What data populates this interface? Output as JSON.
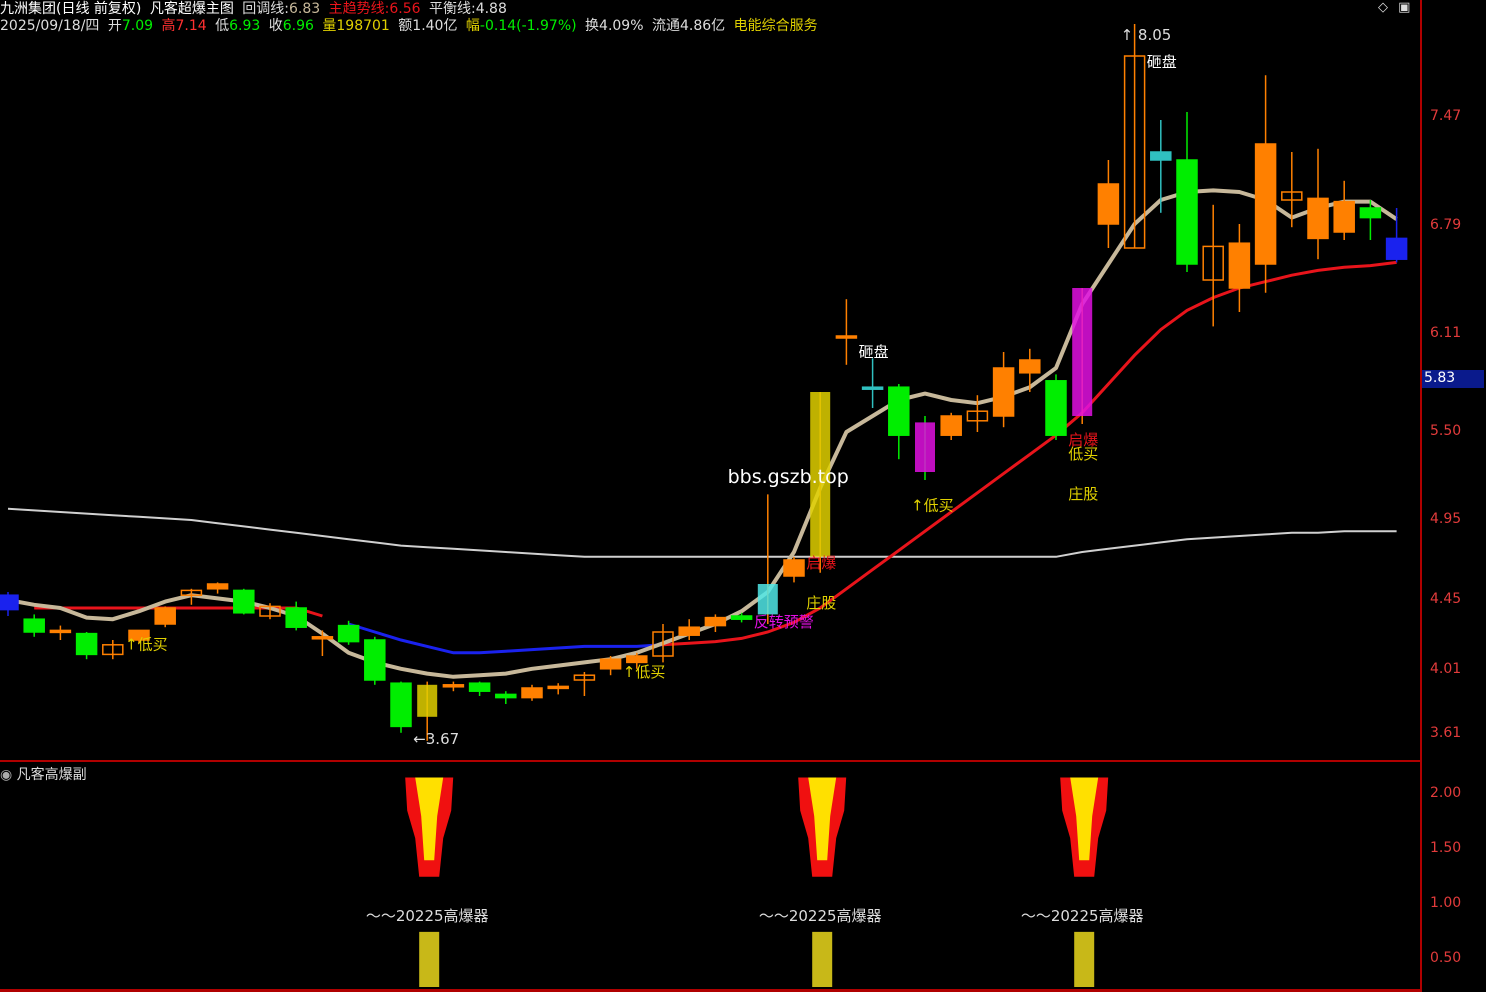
{
  "header": {
    "stock": "九洲集团(日线 前复权)",
    "indicator_name": "凡客超爆主图",
    "callback_label": "回调线:",
    "callback_value": "6.83",
    "trend_label": "主趋势线:",
    "trend_value": "6.56",
    "balance_label": "平衡线:",
    "balance_value": "4.88",
    "date": "2025/09/18/四",
    "open_label": "开",
    "open": "7.09",
    "high_label": "高",
    "high": "7.14",
    "low_label": "低",
    "low": "6.93",
    "close_label": "收",
    "close": "6.96",
    "vol_label": "量",
    "vol": "198701",
    "amt_label": "额",
    "amt": "1.40亿",
    "chg_label": "幅",
    "chg": "-0.14(-1.97%)",
    "turn_label": "换",
    "turn": "4.09%",
    "float_label": "流通",
    "float": "4.86亿",
    "sector": "电能综合服务"
  },
  "sub_panel": {
    "title": "凡客高爆副"
  },
  "colors": {
    "up": "#ff8000",
    "down": "#00ee00",
    "trend": "#e8141b",
    "callback": "#c7b89a",
    "balance": "#d0d0d0",
    "blue": "#1a22ee",
    "magenta": "#e010e0",
    "yellow": "#e0d000"
  },
  "chart_data": [
    {
      "type": "candlestick",
      "title": "凡客超爆主图",
      "ylim": [
        3.5,
        7.95
      ],
      "price_ticks": [
        "7.47",
        "6.79",
        "6.11",
        "5.83",
        "5.50",
        "4.95",
        "4.45",
        "4.01",
        "3.61"
      ],
      "current_price": "5.83",
      "candles": [
        {
          "o": 4.39,
          "c": 4.48,
          "h": 4.5,
          "l": 4.35
        },
        {
          "o": 4.33,
          "c": 4.25,
          "h": 4.36,
          "l": 4.22
        },
        {
          "o": 4.26,
          "c": 4.26,
          "h": 4.29,
          "l": 4.2
        },
        {
          "o": 4.24,
          "c": 4.11,
          "h": 4.25,
          "l": 4.08
        },
        {
          "o": 4.11,
          "c": 4.17,
          "h": 4.2,
          "l": 4.08
        },
        {
          "o": 4.2,
          "c": 4.26,
          "h": 4.26,
          "l": 4.18
        },
        {
          "o": 4.3,
          "c": 4.4,
          "h": 4.41,
          "l": 4.28
        },
        {
          "o": 4.48,
          "c": 4.51,
          "h": 4.52,
          "l": 4.42
        },
        {
          "o": 4.52,
          "c": 4.55,
          "h": 4.56,
          "l": 4.49
        },
        {
          "o": 4.51,
          "c": 4.37,
          "h": 4.52,
          "l": 4.36
        },
        {
          "o": 4.35,
          "c": 4.41,
          "h": 4.43,
          "l": 4.33
        },
        {
          "o": 4.4,
          "c": 4.28,
          "h": 4.44,
          "l": 4.26
        },
        {
          "o": 4.22,
          "c": 4.22,
          "h": 4.26,
          "l": 4.1
        },
        {
          "o": 4.29,
          "c": 4.19,
          "h": 4.32,
          "l": 4.17
        },
        {
          "o": 4.2,
          "c": 3.95,
          "h": 4.22,
          "l": 3.92
        },
        {
          "o": 3.93,
          "c": 3.66,
          "h": 3.94,
          "l": 3.62
        },
        {
          "o": 3.72,
          "c": 3.92,
          "h": 3.94,
          "l": 3.57
        },
        {
          "o": 3.92,
          "c": 3.92,
          "h": 3.94,
          "l": 3.88
        },
        {
          "o": 3.93,
          "c": 3.88,
          "h": 3.94,
          "l": 3.85
        },
        {
          "o": 3.86,
          "c": 3.84,
          "h": 3.88,
          "l": 3.8
        },
        {
          "o": 3.84,
          "c": 3.9,
          "h": 3.92,
          "l": 3.82
        },
        {
          "o": 3.9,
          "c": 3.91,
          "h": 3.93,
          "l": 3.86
        },
        {
          "o": 3.95,
          "c": 3.98,
          "h": 4.0,
          "l": 3.85
        },
        {
          "o": 4.02,
          "c": 4.08,
          "h": 4.1,
          "l": 3.98
        },
        {
          "o": 4.06,
          "c": 4.1,
          "h": 4.12,
          "l": 4.02
        },
        {
          "o": 4.1,
          "c": 4.25,
          "h": 4.3,
          "l": 4.06
        },
        {
          "o": 4.23,
          "c": 4.28,
          "h": 4.33,
          "l": 4.2
        },
        {
          "o": 4.29,
          "c": 4.34,
          "h": 4.36,
          "l": 4.25
        },
        {
          "o": 4.35,
          "c": 4.33,
          "h": 4.37,
          "l": 4.31
        },
        {
          "o": 4.36,
          "c": 4.55,
          "h": 5.11,
          "l": 4.3
        },
        {
          "o": 4.6,
          "c": 4.7,
          "h": 4.72,
          "l": 4.56
        },
        {
          "o": 4.72,
          "c": 5.75,
          "h": 5.75,
          "l": 4.62
        },
        {
          "o": 6.1,
          "c": 6.1,
          "h": 6.33,
          "l": 5.92
        },
        {
          "o": 5.78,
          "c": 5.78,
          "h": 5.96,
          "l": 5.65
        },
        {
          "o": 5.78,
          "c": 5.48,
          "h": 5.8,
          "l": 5.33
        },
        {
          "o": 5.56,
          "c": 5.25,
          "h": 5.6,
          "l": 5.2
        },
        {
          "o": 5.48,
          "c": 5.6,
          "h": 5.62,
          "l": 5.45
        },
        {
          "o": 5.57,
          "c": 5.63,
          "h": 5.73,
          "l": 5.5
        },
        {
          "o": 5.6,
          "c": 5.9,
          "h": 6.0,
          "l": 5.53
        },
        {
          "o": 5.87,
          "c": 5.95,
          "h": 6.02,
          "l": 5.75
        },
        {
          "o": 5.82,
          "c": 5.48,
          "h": 5.86,
          "l": 5.45
        },
        {
          "o": 5.6,
          "c": 6.4,
          "h": 6.4,
          "l": 5.55
        },
        {
          "o": 6.8,
          "c": 7.05,
          "h": 7.2,
          "l": 6.65
        },
        {
          "o": 6.65,
          "c": 7.85,
          "h": 8.05,
          "l": 6.65
        },
        {
          "o": 7.2,
          "c": 7.25,
          "h": 7.45,
          "l": 6.87
        },
        {
          "o": 7.2,
          "c": 6.55,
          "h": 7.5,
          "l": 6.5
        },
        {
          "o": 6.45,
          "c": 6.66,
          "h": 6.92,
          "l": 6.16
        },
        {
          "o": 6.4,
          "c": 6.68,
          "h": 6.8,
          "l": 6.25
        },
        {
          "o": 6.55,
          "c": 7.3,
          "h": 7.73,
          "l": 6.37
        },
        {
          "o": 6.95,
          "c": 7.0,
          "h": 7.25,
          "l": 6.78
        },
        {
          "o": 6.71,
          "c": 6.96,
          "h": 7.27,
          "l": 6.58
        },
        {
          "o": 6.75,
          "c": 6.94,
          "h": 7.07,
          "l": 6.7
        },
        {
          "o": 6.9,
          "c": 6.84,
          "h": 6.95,
          "l": 6.7
        },
        {
          "o": 6.71,
          "c": 6.58,
          "h": 6.9,
          "l": 6.56
        }
      ],
      "callback_line": [
        4.45,
        4.42,
        4.4,
        4.34,
        4.33,
        4.38,
        4.44,
        4.48,
        4.46,
        4.44,
        4.4,
        4.35,
        4.24,
        4.12,
        4.06,
        4.02,
        3.99,
        3.97,
        3.98,
        3.99,
        4.02,
        4.04,
        4.06,
        4.08,
        4.12,
        4.18,
        4.24,
        4.3,
        4.38,
        4.5,
        4.75,
        5.15,
        5.5,
        5.6,
        5.7,
        5.74,
        5.7,
        5.68,
        5.72,
        5.78,
        5.9,
        6.3,
        6.55,
        6.8,
        6.95,
        7.0,
        7.01,
        7.0,
        6.95,
        6.84,
        6.9,
        6.94,
        6.94,
        6.83
      ],
      "trend_line": [
        4.4,
        4.4,
        4.4,
        4.4,
        4.4,
        4.4,
        4.4,
        4.4,
        4.4,
        4.4,
        4.4,
        4.35,
        4.3,
        4.25,
        4.2,
        4.16,
        4.12,
        4.12,
        4.13,
        4.14,
        4.15,
        4.16,
        4.16,
        4.16,
        4.17,
        4.18,
        4.19,
        4.21,
        4.25,
        4.31,
        4.4,
        4.52,
        4.64,
        4.76,
        4.88,
        5.0,
        5.12,
        5.24,
        5.36,
        5.48,
        5.62,
        5.8,
        5.98,
        6.14,
        6.26,
        6.34,
        6.4,
        6.44,
        6.48,
        6.51,
        6.53,
        6.54,
        6.56
      ],
      "balance_line": [
        5.02,
        5.01,
        5.0,
        4.99,
        4.98,
        4.97,
        4.96,
        4.95,
        4.93,
        4.91,
        4.89,
        4.87,
        4.85,
        4.83,
        4.81,
        4.79,
        4.78,
        4.77,
        4.76,
        4.75,
        4.74,
        4.73,
        4.72,
        4.72,
        4.72,
        4.72,
        4.72,
        4.72,
        4.72,
        4.72,
        4.72,
        4.72,
        4.72,
        4.72,
        4.72,
        4.72,
        4.72,
        4.72,
        4.72,
        4.72,
        4.72,
        4.75,
        4.77,
        4.79,
        4.81,
        4.83,
        4.84,
        4.85,
        4.86,
        4.87,
        4.87,
        4.88,
        4.88,
        4.88
      ],
      "annotations": [
        {
          "text": "↑低买",
          "i": 5,
          "price": 4.14,
          "color": "#e0d000"
        },
        {
          "text": "←3.67",
          "i": 16,
          "price": 3.55,
          "color": "#dddddd"
        },
        {
          "text": "↑低买",
          "i": 24,
          "price": 3.97,
          "color": "#e0d000"
        },
        {
          "text": "反转预警",
          "i": 29,
          "price": 4.28,
          "color": "#e010e0"
        },
        {
          "text": "庄股",
          "i": 31,
          "price": 4.4,
          "color": "#e0d000"
        },
        {
          "text": "启爆",
          "i": 31,
          "price": 4.65,
          "color": "#e8141b"
        },
        {
          "text": "bbs.gszb.top",
          "i": 28,
          "price": 5.18,
          "color": "#ffffff"
        },
        {
          "text": "砸盘",
          "i": 33,
          "price": 5.97,
          "color": "#ffffff"
        },
        {
          "text": "↑低买",
          "i": 35,
          "price": 5.01,
          "color": "#e0d000"
        },
        {
          "text": "低买",
          "i": 41,
          "price": 5.33,
          "color": "#e0d000"
        },
        {
          "text": "启爆",
          "i": 41,
          "price": 5.42,
          "color": "#e8141b"
        },
        {
          "text": "庄股",
          "i": 41,
          "price": 5.08,
          "color": "#e0d000"
        },
        {
          "text": "砸盘",
          "i": 44,
          "price": 7.78,
          "color": "#ffffff"
        },
        {
          "text": "↑ 8.05",
          "i": 43,
          "price": 7.95,
          "color": "#dddddd"
        }
      ]
    },
    {
      "type": "bar",
      "title": "凡客高爆副",
      "ylim": [
        0.25,
        2.2
      ],
      "y_ticks": [
        "2.00",
        "1.50",
        "1.00",
        "0.50"
      ],
      "signal_indices": [
        16,
        31,
        41
      ],
      "label": "～～20225高爆器"
    }
  ]
}
